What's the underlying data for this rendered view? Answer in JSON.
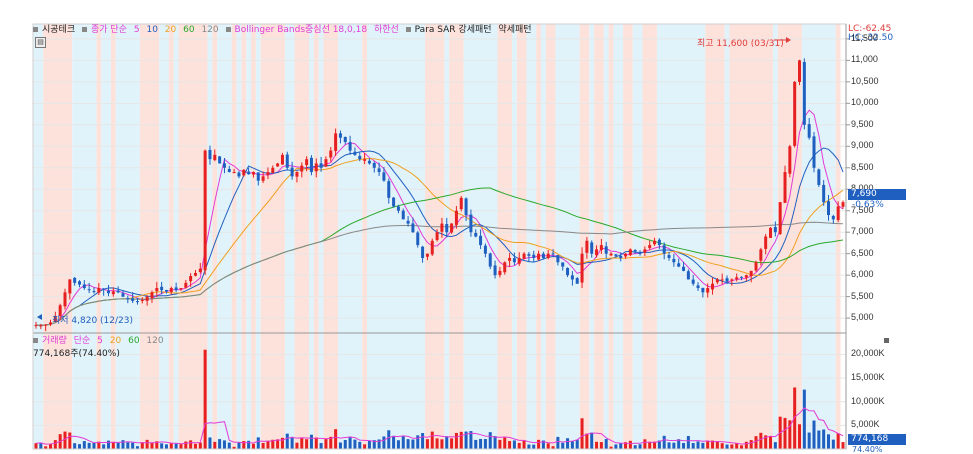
{
  "legend": {
    "stock_name": "시공테크",
    "price_label": "종가 단순",
    "ma_periods": [
      "5",
      "10",
      "20",
      "60",
      "120"
    ],
    "ma_colors": [
      "#e23bd6",
      "#1f5fbf",
      "#f0a020",
      "#2aa82a",
      "#888888"
    ],
    "bollinger": "Bollinger Bands중심선 18,0,18",
    "bollinger_lower": "하한선",
    "sar": "Para SAR 강세패턴",
    "sar_weak": "약세패턴"
  },
  "icons": {
    "chart_toggle": "chart-toggle-icon"
  },
  "price_axis": {
    "lc": "LC:-62.45",
    "hc": "HC:-32.50",
    "ticks": [
      "11,500",
      "11,000",
      "10,500",
      "10,000",
      "9,500",
      "9,000",
      "8,500",
      "8,000",
      "7,500",
      "7,000",
      "6,500",
      "6,000",
      "5,500",
      "5,000"
    ],
    "current_price": "7,690",
    "current_change": "-0.63%"
  },
  "annotations": {
    "high": "최고 11,600 (03/31)",
    "low": "최저 4,820 (12/23)"
  },
  "volume_legend": {
    "label": "거래량",
    "ma_label": "단순",
    "periods": [
      "5",
      "20",
      "60",
      "120"
    ],
    "period_colors": [
      "#e23bd6",
      "#f0a020",
      "#2aa82a",
      "#888888"
    ],
    "current_volume": "774,168주(74.40%)"
  },
  "volume_axis": {
    "ticks": [
      "20,000K",
      "15,000K",
      "10,000K",
      "5,000K"
    ],
    "current_value": "774,168",
    "current_pct": "74.40%"
  },
  "colors": {
    "up": "#e62020",
    "down": "#1f5fbf",
    "bull_band": "#fde2dc",
    "bear_band": "#e0f3fb"
  },
  "chart_data": {
    "type": "candlestick",
    "ylim": [
      4700,
      11800
    ],
    "volume_ylim": [
      0,
      22000
    ],
    "price_path": [
      4840,
      4830,
      4850,
      4900,
      5050,
      5300,
      5600,
      5900,
      5820,
      5780,
      5700,
      5650,
      5620,
      5700,
      5660,
      5580,
      5620,
      5600,
      5500,
      5450,
      5400,
      5380,
      5420,
      5500,
      5600,
      5700,
      5650,
      5620,
      5700,
      5650,
      5700,
      5820,
      5980,
      6050,
      6150,
      8900,
      8700,
      8800,
      8600,
      8500,
      8400,
      8400,
      8300,
      8450,
      8350,
      8400,
      8200,
      8300,
      8400,
      8500,
      8600,
      8800,
      8500,
      8300,
      8400,
      8550,
      8700,
      8400,
      8600,
      8500,
      8700,
      8900,
      9300,
      9200,
      9100,
      8900,
      8800,
      8700,
      8700,
      8600,
      8500,
      8400,
      8200,
      7800,
      7600,
      7500,
      7300,
      7200,
      7000,
      6700,
      6400,
      6500,
      6800,
      7000,
      7200,
      7000,
      7200,
      7500,
      7800,
      7400,
      7000,
      6900,
      6700,
      6500,
      6200,
      6000,
      6100,
      6300,
      6400,
      6300,
      6400,
      6500,
      6450,
      6400,
      6500,
      6400,
      6500,
      6500,
      6300,
      6200,
      6000,
      5900,
      5800,
      6500,
      6800,
      6500,
      6600,
      6700,
      6500,
      6500,
      6450,
      6400,
      6500,
      6600,
      6550,
      6500,
      6600,
      6700,
      6800,
      6700,
      6500,
      6400,
      6300,
      6200,
      6100,
      5900,
      5800,
      5700,
      5600,
      5700,
      5800,
      5900,
      5900,
      5850,
      5900,
      5950,
      5950,
      6000,
      6100,
      6300,
      6600,
      6900,
      7100,
      7000,
      7700,
      8400,
      9000,
      10500,
      11000,
      9500,
      9200,
      8500,
      8100,
      7700,
      7400,
      7300,
      7600,
      7700
    ]
  }
}
